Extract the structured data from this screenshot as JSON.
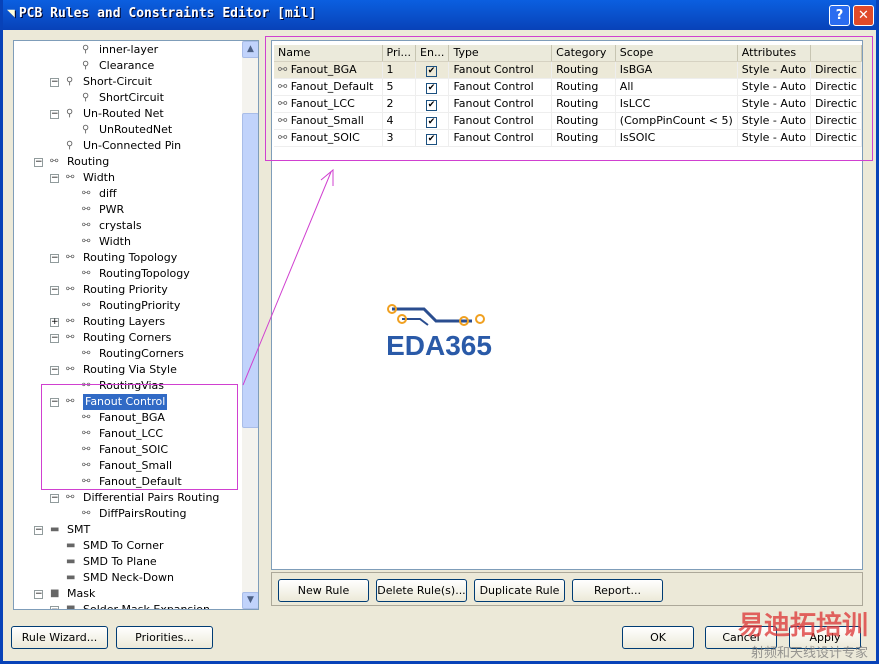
{
  "window": {
    "title": "PCB Rules and Constraints Editor [mil]",
    "help": "?",
    "close": "✕"
  },
  "tree": [
    {
      "label": "inner-layer",
      "level": 3,
      "icon": "clearance"
    },
    {
      "label": "Clearance",
      "level": 3,
      "icon": "clearance"
    },
    {
      "label": "Short-Circuit",
      "level": 2,
      "icon": "clearance",
      "exp": "-"
    },
    {
      "label": "ShortCircuit",
      "level": 3,
      "icon": "clearance"
    },
    {
      "label": "Un-Routed Net",
      "level": 2,
      "icon": "clearance",
      "exp": "-"
    },
    {
      "label": "UnRoutedNet",
      "level": 3,
      "icon": "clearance"
    },
    {
      "label": "Un-Connected Pin",
      "level": 2,
      "icon": "clearance"
    },
    {
      "label": "Routing",
      "level": 1,
      "icon": "routing",
      "exp": "-"
    },
    {
      "label": "Width",
      "level": 2,
      "icon": "routing",
      "exp": "-"
    },
    {
      "label": "diff",
      "level": 3,
      "icon": "routing"
    },
    {
      "label": "PWR",
      "level": 3,
      "icon": "routing"
    },
    {
      "label": "crystals",
      "level": 3,
      "icon": "routing"
    },
    {
      "label": "Width",
      "level": 3,
      "icon": "routing"
    },
    {
      "label": "Routing Topology",
      "level": 2,
      "icon": "routing",
      "exp": "-"
    },
    {
      "label": "RoutingTopology",
      "level": 3,
      "icon": "routing"
    },
    {
      "label": "Routing Priority",
      "level": 2,
      "icon": "routing",
      "exp": "-"
    },
    {
      "label": "RoutingPriority",
      "level": 3,
      "icon": "routing"
    },
    {
      "label": "Routing Layers",
      "level": 2,
      "icon": "routing",
      "exp": "+"
    },
    {
      "label": "Routing Corners",
      "level": 2,
      "icon": "routing",
      "exp": "-"
    },
    {
      "label": "RoutingCorners",
      "level": 3,
      "icon": "routing"
    },
    {
      "label": "Routing Via Style",
      "level": 2,
      "icon": "routing",
      "exp": "-"
    },
    {
      "label": "RoutingVias",
      "level": 3,
      "icon": "routing"
    },
    {
      "label": "Fanout Control",
      "level": 2,
      "icon": "routing",
      "exp": "-",
      "selected": true
    },
    {
      "label": "Fanout_BGA",
      "level": 3,
      "icon": "routing"
    },
    {
      "label": "Fanout_LCC",
      "level": 3,
      "icon": "routing"
    },
    {
      "label": "Fanout_SOIC",
      "level": 3,
      "icon": "routing"
    },
    {
      "label": "Fanout_Small",
      "level": 3,
      "icon": "routing"
    },
    {
      "label": "Fanout_Default",
      "level": 3,
      "icon": "routing"
    },
    {
      "label": "Differential Pairs Routing",
      "level": 2,
      "icon": "routing",
      "exp": "-"
    },
    {
      "label": "DiffPairsRouting",
      "level": 3,
      "icon": "routing"
    },
    {
      "label": "SMT",
      "level": 1,
      "icon": "smt",
      "exp": "-"
    },
    {
      "label": "SMD To Corner",
      "level": 2,
      "icon": "smt"
    },
    {
      "label": "SMD To Plane",
      "level": 2,
      "icon": "smt"
    },
    {
      "label": "SMD Neck-Down",
      "level": 2,
      "icon": "smt"
    },
    {
      "label": "Mask",
      "level": 1,
      "icon": "mask",
      "exp": "-"
    },
    {
      "label": "Solder Mask Expansion",
      "level": 2,
      "icon": "mask",
      "exp": "-"
    }
  ],
  "table": {
    "columns": [
      "Name",
      "Pri...",
      "En...",
      "Type",
      "Category",
      "Scope",
      "Attributes",
      ""
    ],
    "rows": [
      [
        "Fanout_BGA",
        "1",
        true,
        "Fanout Control",
        "Routing",
        "IsBGA",
        "Style - Auto",
        "Directic"
      ],
      [
        "Fanout_Default",
        "5",
        true,
        "Fanout Control",
        "Routing",
        "All",
        "Style - Auto",
        "Directic"
      ],
      [
        "Fanout_LCC",
        "2",
        true,
        "Fanout Control",
        "Routing",
        "IsLCC",
        "Style - Auto",
        "Directic"
      ],
      [
        "Fanout_Small",
        "4",
        true,
        "Fanout Control",
        "Routing",
        "(CompPinCount < 5)",
        "Style - Auto",
        "Directic"
      ],
      [
        "Fanout_SOIC",
        "3",
        true,
        "Fanout Control",
        "Routing",
        "IsSOIC",
        "Style - Auto",
        "Directic"
      ]
    ]
  },
  "rule_buttons": {
    "new": "New Rule",
    "delete": "Delete Rule(s)...",
    "duplicate": "Duplicate Rule",
    "report": "Report..."
  },
  "footer": {
    "wizard": "Rule Wizard...",
    "priorities": "Priorities...",
    "ok": "OK",
    "cancel": "Cancel",
    "apply": "Apply"
  },
  "logo": "EDA365",
  "watermark": {
    "line1": "易迪拓培训",
    "line2": "射频和天线设计专家"
  },
  "colors": {
    "selection": "#316ac5",
    "annotation": "#d040d0"
  }
}
